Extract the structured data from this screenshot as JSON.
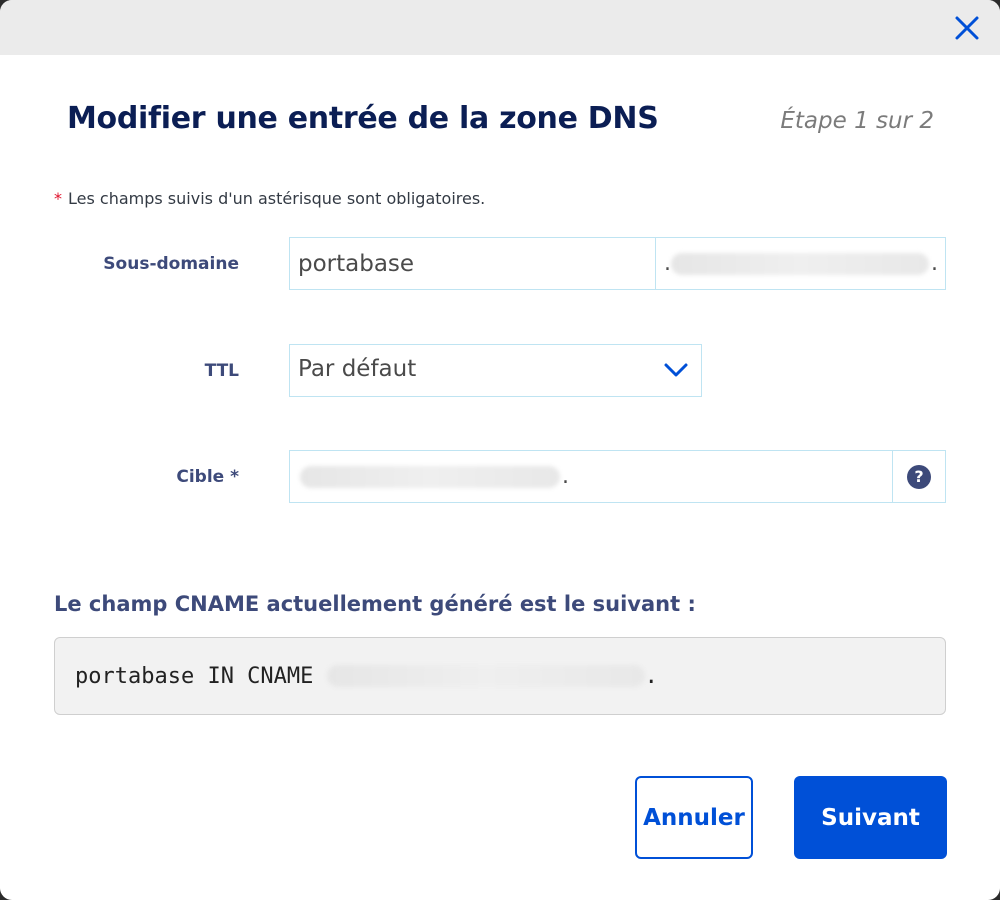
{
  "dialog": {
    "close_icon": "close-icon",
    "title": "Modifier une entrée de la zone DNS",
    "step": "Étape 1 sur 2",
    "required_note": "Les champs suivis d'un astérisque sont obligatoires.",
    "required_mark": "*"
  },
  "form": {
    "subdomain": {
      "label": "Sous-domaine",
      "value": "portabase",
      "suffix_prefix": ".",
      "suffix_end": "."
    },
    "ttl": {
      "label": "TTL",
      "value": "Par défaut"
    },
    "target": {
      "label": "Cible *",
      "end": ".",
      "help_icon": "question-icon",
      "help_glyph": "?"
    }
  },
  "cname": {
    "title": "Le champ CNAME actuellement généré est le suivant :",
    "record_prefix": "portabase IN CNAME ",
    "record_end": "."
  },
  "buttons": {
    "cancel_label": "Annuler",
    "next_label": "Suivant"
  },
  "colors": {
    "primary": "#0050d7",
    "title": "#0b1e54",
    "label": "#3d4a7a",
    "field_border": "#bfe4f2",
    "required": "#e0112b"
  }
}
